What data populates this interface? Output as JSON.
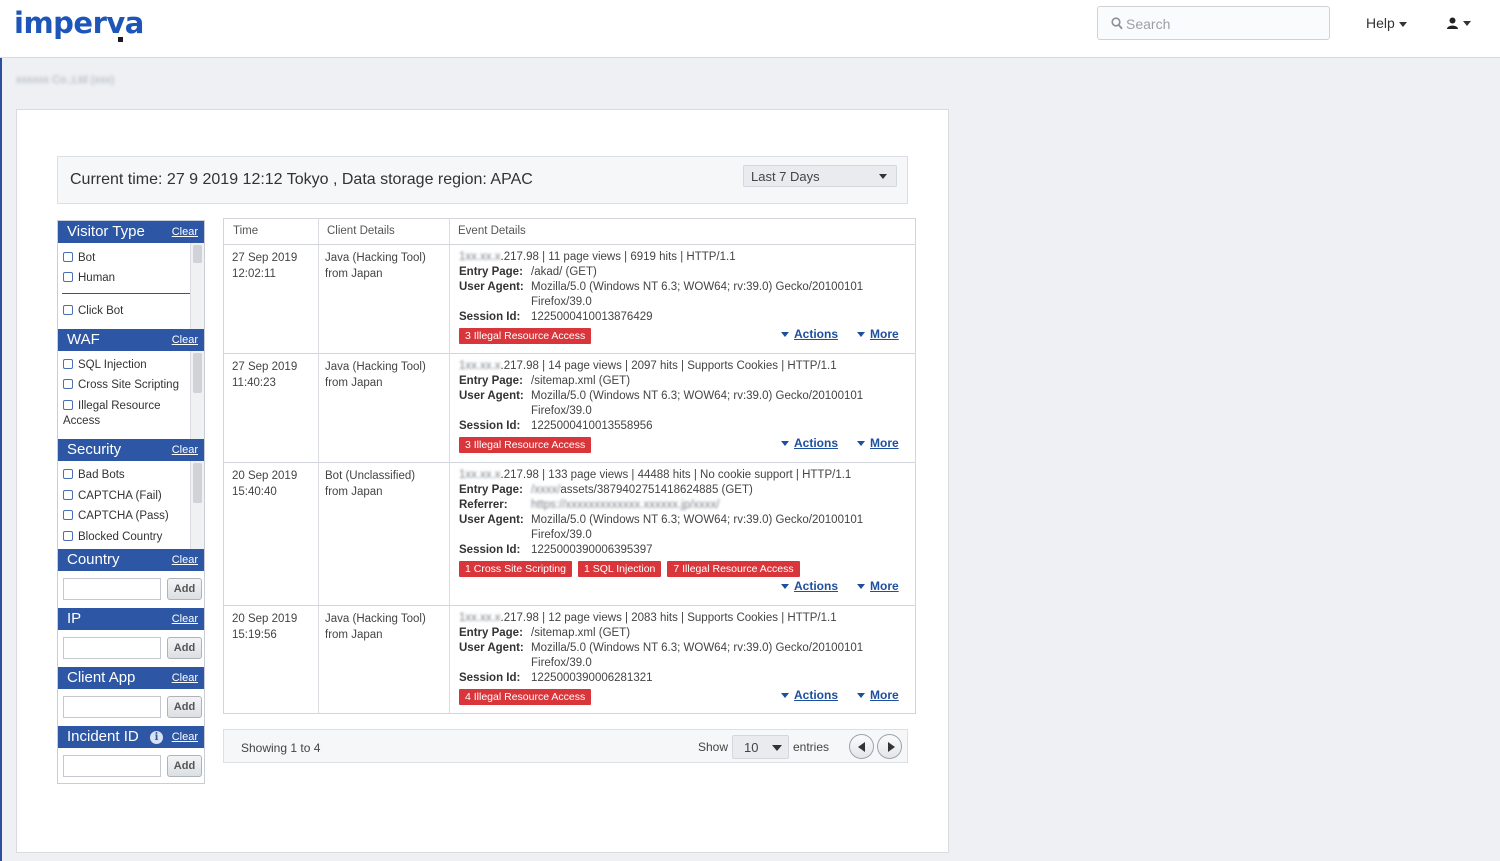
{
  "brand": {
    "logo_text": "imperva"
  },
  "header": {
    "search_placeholder": "Search",
    "help_label": "Help",
    "user_icon": "user-icon"
  },
  "account": {
    "name": "xxxxxx Co.,Ltd (xxx)"
  },
  "time_bar": {
    "text": "Current time: 27 9 2019 12:12 Tokyo , Data storage region: APAC",
    "range": "Last 7 Days"
  },
  "sidebar": {
    "clear_label": "Clear",
    "add_label": "Add",
    "visitor_type": {
      "title": "Visitor Type",
      "items": [
        "Bot",
        "Human",
        "Click Bot"
      ]
    },
    "waf": {
      "title": "WAF",
      "items": [
        "SQL Injection",
        "Cross Site Scripting",
        "Illegal Resource",
        "Access"
      ]
    },
    "security": {
      "title": "Security",
      "items": [
        "Bad Bots",
        "CAPTCHA (Fail)",
        "CAPTCHA (Pass)",
        "Blocked Country"
      ]
    },
    "country": {
      "title": "Country",
      "input": ""
    },
    "ip": {
      "title": "IP",
      "input": ""
    },
    "client_app": {
      "title": "Client App",
      "input": ""
    },
    "incident_id": {
      "title": "Incident ID",
      "input": ""
    }
  },
  "table": {
    "headers": [
      "Time",
      "Client Details",
      "Event Details"
    ],
    "actions_label": "Actions",
    "more_label": "More",
    "labels": {
      "entry_page": "Entry Page:",
      "user_agent": "User Agent:",
      "session_id": "Session Id:",
      "referrer": "Referrer:"
    },
    "rows": [
      {
        "date": "27 Sep 2019",
        "time": "12:02:11",
        "client": "Java (Hacking Tool)",
        "from": "from Japan",
        "ip_masked": "1xx.xx.x",
        "summary": ".217.98 | 11 page views | 6919 hits | HTTP/1.1",
        "entry_page": "/akad/ (GET)",
        "user_agent_1": "Mozilla/5.0 (Windows NT 6.3; WOW64; rv:39.0) Gecko/20100101",
        "user_agent_2": "Firefox/39.0",
        "session_id": "1225000410013876429",
        "tags": [
          "3 Illegal Resource Access"
        ]
      },
      {
        "date": "27 Sep 2019",
        "time": "11:40:23",
        "client": "Java (Hacking Tool)",
        "from": "from Japan",
        "ip_masked": "1xx.xx.x",
        "summary": ".217.98 | 14 page views | 2097 hits | Supports Cookies | HTTP/1.1",
        "entry_page": "/sitemap.xml (GET)",
        "user_agent_1": "Mozilla/5.0 (Windows NT 6.3; WOW64; rv:39.0) Gecko/20100101",
        "user_agent_2": "Firefox/39.0",
        "session_id": "1225000410013558956",
        "tags": [
          "3 Illegal Resource Access"
        ]
      },
      {
        "date": "20 Sep 2019",
        "time": "15:40:40",
        "client": "Bot (Unclassified)",
        "from": "from Japan",
        "ip_masked": "1xx.xx.x",
        "summary": ".217.98 | 133 page views | 44488 hits | No cookie support | HTTP/1.1",
        "entry_page_masked": "/xxxx/",
        "entry_page": "assets/3879402751418624885 (GET)",
        "referrer_masked": "https://xxxxxxxxxxxxx.xxxxxx.jp/xxxx/",
        "user_agent_1": "Mozilla/5.0 (Windows NT 6.3; WOW64; rv:39.0) Gecko/20100101",
        "user_agent_2": "Firefox/39.0",
        "session_id": "1225000390006395397",
        "tags": [
          "1 Cross Site Scripting",
          "1 SQL Injection",
          "7 Illegal Resource Access"
        ]
      },
      {
        "date": "20 Sep 2019",
        "time": "15:19:56",
        "client": "Java (Hacking Tool)",
        "from": "from Japan",
        "ip_masked": "1xx.xx.x",
        "summary": ".217.98 | 12 page views | 2083 hits | Supports Cookies | HTTP/1.1",
        "entry_page": "/sitemap.xml (GET)",
        "user_agent_1": "Mozilla/5.0 (Windows NT 6.3; WOW64; rv:39.0) Gecko/20100101",
        "user_agent_2": "Firefox/39.0",
        "session_id": "1225000390006281321",
        "tags": [
          "4 Illegal Resource Access"
        ]
      }
    ]
  },
  "footer": {
    "showing": "Showing 1 to 4",
    "show_label": "Show",
    "page_size": "10",
    "entries_label": "entries"
  },
  "colors": {
    "brand_blue": "#1d55b8",
    "filter_header": "#2d56a4",
    "tag_red": "#d9363b",
    "link_blue": "#1d4f9f"
  }
}
